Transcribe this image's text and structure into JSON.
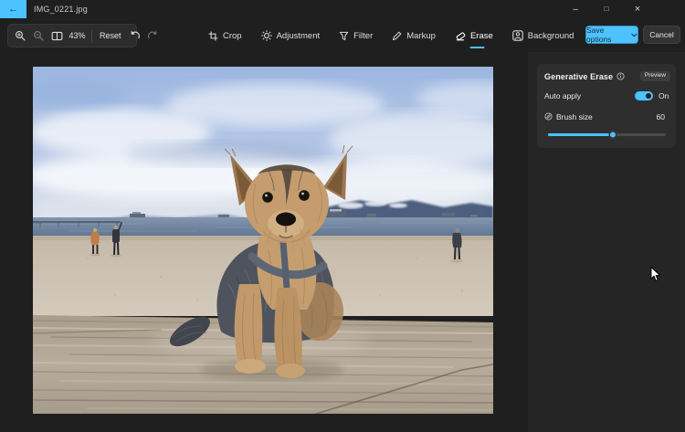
{
  "colors": {
    "accent": "#4cc2ff"
  },
  "titlebar": {
    "back_icon": "←",
    "filename": "IMG_0221.jpg",
    "minimize_icon": "–",
    "maximize_icon": "□",
    "close_icon": "×"
  },
  "toolbar": {
    "zoom_value": "43%",
    "reset_label": "Reset"
  },
  "tabs": [
    {
      "label": "Crop",
      "selected": false
    },
    {
      "label": "Adjustment",
      "selected": false
    },
    {
      "label": "Filter",
      "selected": false
    },
    {
      "label": "Markup",
      "selected": false
    },
    {
      "label": "Erase",
      "selected": true
    },
    {
      "label": "Background",
      "selected": false
    }
  ],
  "actions": {
    "save_label": "Save options",
    "cancel_label": "Cancel"
  },
  "panel": {
    "title": "Generative Erase",
    "badge": "Preview",
    "auto_apply_label": "Auto apply",
    "auto_apply_state": "On",
    "brush_label": "Brush size",
    "brush_value": "60",
    "brush_slider_percent": 55
  }
}
